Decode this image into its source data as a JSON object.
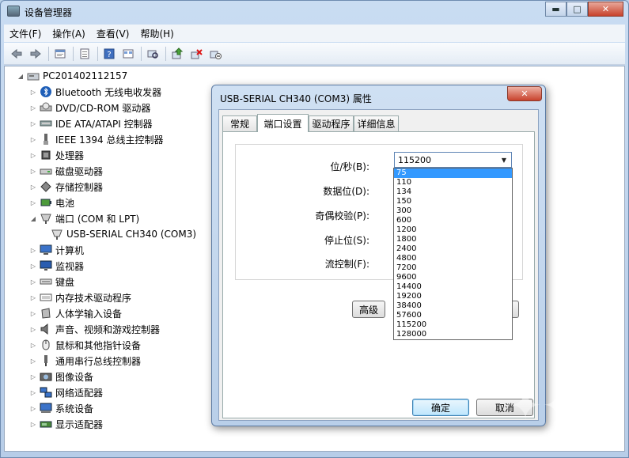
{
  "window": {
    "title": "设备管理器",
    "minimize": "▬",
    "maximize": "□",
    "close": "✕"
  },
  "menu": [
    "文件(F)",
    "操作(A)",
    "查看(V)",
    "帮助(H)"
  ],
  "toolbar": {
    "icons": [
      "back-arrow-icon",
      "forward-arrow-icon",
      "properties-icon",
      "list-icon",
      "help-icon",
      "view-icon",
      "scan-icon",
      "update-driver-icon",
      "uninstall-icon",
      "disable-icon"
    ]
  },
  "tree": {
    "root": "PC201402112157",
    "items": [
      {
        "label": "Bluetooth 无线电收发器",
        "icon": "bluetooth-icon"
      },
      {
        "label": "DVD/CD-ROM 驱动器",
        "icon": "dvd-icon"
      },
      {
        "label": "IDE ATA/ATAPI 控制器",
        "icon": "ide-controller-icon"
      },
      {
        "label": "IEEE 1394 总线主控制器",
        "icon": "ieee1394-icon"
      },
      {
        "label": "处理器",
        "icon": "processor-icon"
      },
      {
        "label": "磁盘驱动器",
        "icon": "disk-drive-icon"
      },
      {
        "label": "存储控制器",
        "icon": "storage-controller-icon"
      },
      {
        "label": "电池",
        "icon": "battery-icon"
      },
      {
        "label": "端口 (COM 和 LPT)",
        "icon": "port-icon",
        "expanded": true
      },
      {
        "label": "USB-SERIAL CH340 (COM3)",
        "icon": "serial-port-icon",
        "child": true
      },
      {
        "label": "计算机",
        "icon": "computer-icon"
      },
      {
        "label": "监视器",
        "icon": "monitor-icon"
      },
      {
        "label": "键盘",
        "icon": "keyboard-icon"
      },
      {
        "label": "内存技术驱动程序",
        "icon": "memory-icon"
      },
      {
        "label": "人体学输入设备",
        "icon": "hid-icon"
      },
      {
        "label": "声音、视频和游戏控制器",
        "icon": "sound-icon"
      },
      {
        "label": "鼠标和其他指针设备",
        "icon": "mouse-icon"
      },
      {
        "label": "通用串行总线控制器",
        "icon": "usb-icon"
      },
      {
        "label": "图像设备",
        "icon": "imaging-icon"
      },
      {
        "label": "网络适配器",
        "icon": "network-icon"
      },
      {
        "label": "系统设备",
        "icon": "system-device-icon"
      },
      {
        "label": "显示适配器",
        "icon": "display-adapter-icon"
      }
    ]
  },
  "dialog": {
    "title": "USB-SERIAL CH340 (COM3) 属性",
    "close": "✕",
    "tabs": [
      "常规",
      "端口设置",
      "驱动程序",
      "详细信息"
    ],
    "active_tab": 1,
    "fields": {
      "baud_label": "位/秒(B):",
      "data_bits_label": "数据位(D):",
      "parity_label": "奇偶校验(P):",
      "stop_bits_label": "停止位(S):",
      "flow_label": "流控制(F):"
    },
    "baud_value": "115200",
    "baud_options": [
      "75",
      "110",
      "134",
      "150",
      "300",
      "600",
      "1200",
      "1800",
      "2400",
      "4800",
      "7200",
      "9600",
      "14400",
      "19200",
      "38400",
      "57600",
      "115200",
      "128000"
    ],
    "highlighted_option": "75",
    "advanced_button": "高级",
    "restore_button_tail": ")",
    "ok_button": "确定",
    "cancel_button": "取消"
  }
}
